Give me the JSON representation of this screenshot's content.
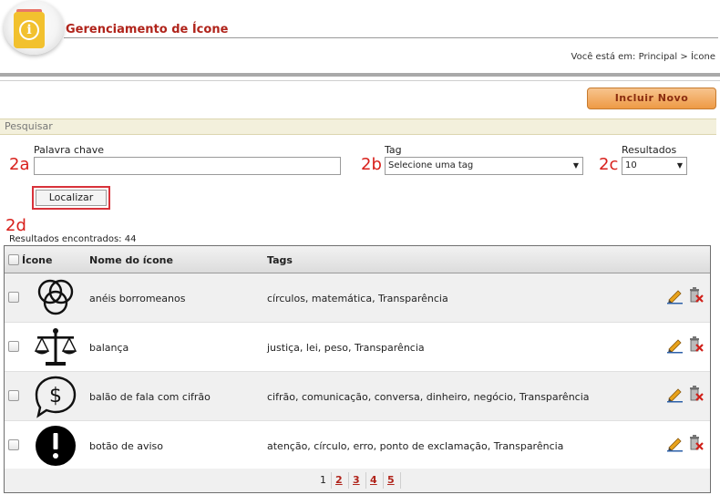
{
  "header": {
    "title": "Gerenciamento de Ícone",
    "breadcrumb": "Você está em: Principal > Ícone"
  },
  "actions": {
    "new_label": "Incluir Novo"
  },
  "search": {
    "section_label": "Pesquisar",
    "keyword_label": "Palavra chave",
    "keyword_value": "",
    "tag_label": "Tag",
    "tag_value": "Selecione uma tag",
    "results_label": "Resultados",
    "results_value": "10",
    "submit_label": "Localizar"
  },
  "markers": {
    "a": "2a",
    "b": "2b",
    "c": "2c",
    "d": "2d"
  },
  "results": {
    "count_text": "Resultados encontrados: 44"
  },
  "table": {
    "columns": {
      "icon": "Ícone",
      "name": "Nome do ícone",
      "tags": "Tags"
    },
    "rows": [
      {
        "icon": "borromean-rings-icon",
        "name": "anéis borromeanos",
        "tags": "círculos, matemática, Transparência"
      },
      {
        "icon": "scale-icon",
        "name": "balança",
        "tags": "justiça, lei, peso, Transparência"
      },
      {
        "icon": "speech-bubble-dollar-icon",
        "name": "balão de fala com cifrão",
        "tags": "cifrão, comunicação, conversa, dinheiro, negócio, Transparência"
      },
      {
        "icon": "warning-button-icon",
        "name": "botão de aviso",
        "tags": "atenção, círculo, erro, ponto de exclamação, Transparência"
      }
    ]
  },
  "pagination": {
    "pages": [
      "1",
      "2",
      "3",
      "4",
      "5"
    ],
    "current": "1"
  },
  "colors": {
    "title_red": "#b0241b",
    "button_orange": "#ee9a45",
    "marker_red": "#d8201b",
    "search_bar": "#f3f0dc"
  }
}
